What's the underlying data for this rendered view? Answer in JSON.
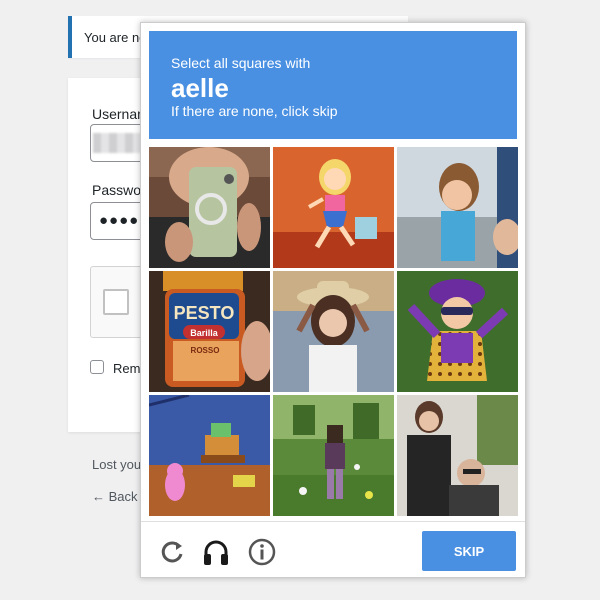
{
  "background": {
    "notice_text": "You are no",
    "username_label": "Usernam",
    "password_label": "Passwo",
    "password_value": "●●●●●",
    "remember_label": "Reme",
    "lost_link": "Lost you",
    "back_link": "← Back t"
  },
  "captcha": {
    "instruction_line1": "Select all squares with",
    "target_word": "aelle",
    "instruction_line2": "If there are none, click skip",
    "tiles": [
      {
        "name": "woman-phone-selfie"
      },
      {
        "name": "cartoon-girl-dress"
      },
      {
        "name": "little-girl-outdoors"
      },
      {
        "name": "pesto-jar"
      },
      {
        "name": "woman-cowboy-hat"
      },
      {
        "name": "purple-cartoon-character"
      },
      {
        "name": "cartoon-room-computer"
      },
      {
        "name": "minecraft-character"
      },
      {
        "name": "women-in-coats"
      }
    ],
    "pesto_brand": "PESTO",
    "pesto_sub": "Barilla",
    "pesto_variety": "ROSSO",
    "skip_label": "SKIP",
    "accent_color": "#4a90e2",
    "icons": [
      "reload-icon",
      "headphones-icon",
      "info-icon"
    ]
  }
}
